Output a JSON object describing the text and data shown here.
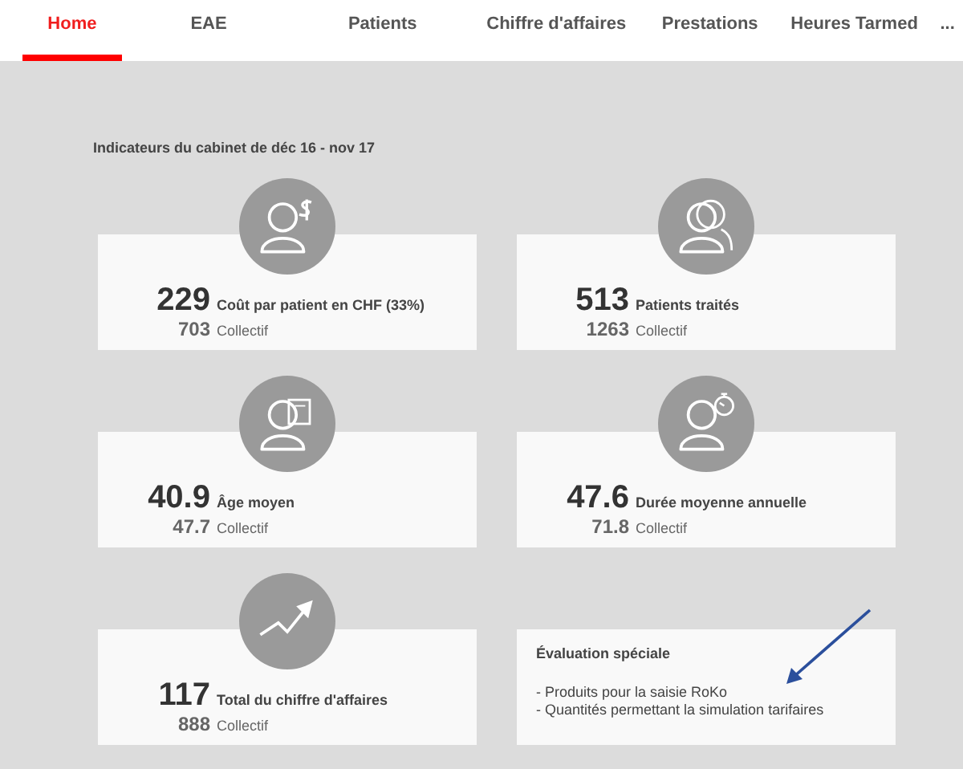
{
  "tabs": [
    {
      "label": "Home",
      "selected": true
    },
    {
      "label": "EAE",
      "selected": false
    },
    {
      "label": "Patients",
      "selected": false
    },
    {
      "label": "Chiffre d'affaires",
      "selected": false
    },
    {
      "label": "Prestations",
      "selected": false
    },
    {
      "label": "Heures Tarmed",
      "selected": false
    },
    {
      "label": "...",
      "selected": false
    }
  ],
  "heading": "Indicateurs du cabinet de déc 16 - nov 17",
  "cards": [
    {
      "kind": "kpi",
      "value": "229",
      "label": "Coût par patient en CHF (33%)",
      "collective_value": "703",
      "collective_label": "Collectif"
    },
    {
      "kind": "kpi",
      "value": "513",
      "label": "Patients traités",
      "collective_value": "1263",
      "collective_label": "Collectif"
    },
    {
      "kind": "kpi",
      "value": "40.9",
      "label": "Âge moyen",
      "collective_value": "47.7",
      "collective_label": "Collectif"
    },
    {
      "kind": "kpi",
      "value": "47.6",
      "label": "Durée moyenne annuelle",
      "collective_value": "71.8",
      "collective_label": "Collectif"
    },
    {
      "kind": "kpi",
      "value": "117",
      "label": "Total du chiffre d'affaires",
      "collective_value": "888",
      "collective_label": "Collectif"
    },
    {
      "kind": "note",
      "title": "Évaluation spéciale",
      "lines": [
        "- Produits pour la saisie RoKo",
        "- Quantités permettant la simulation tarifaires"
      ],
      "annotation_arrow": true
    }
  ]
}
